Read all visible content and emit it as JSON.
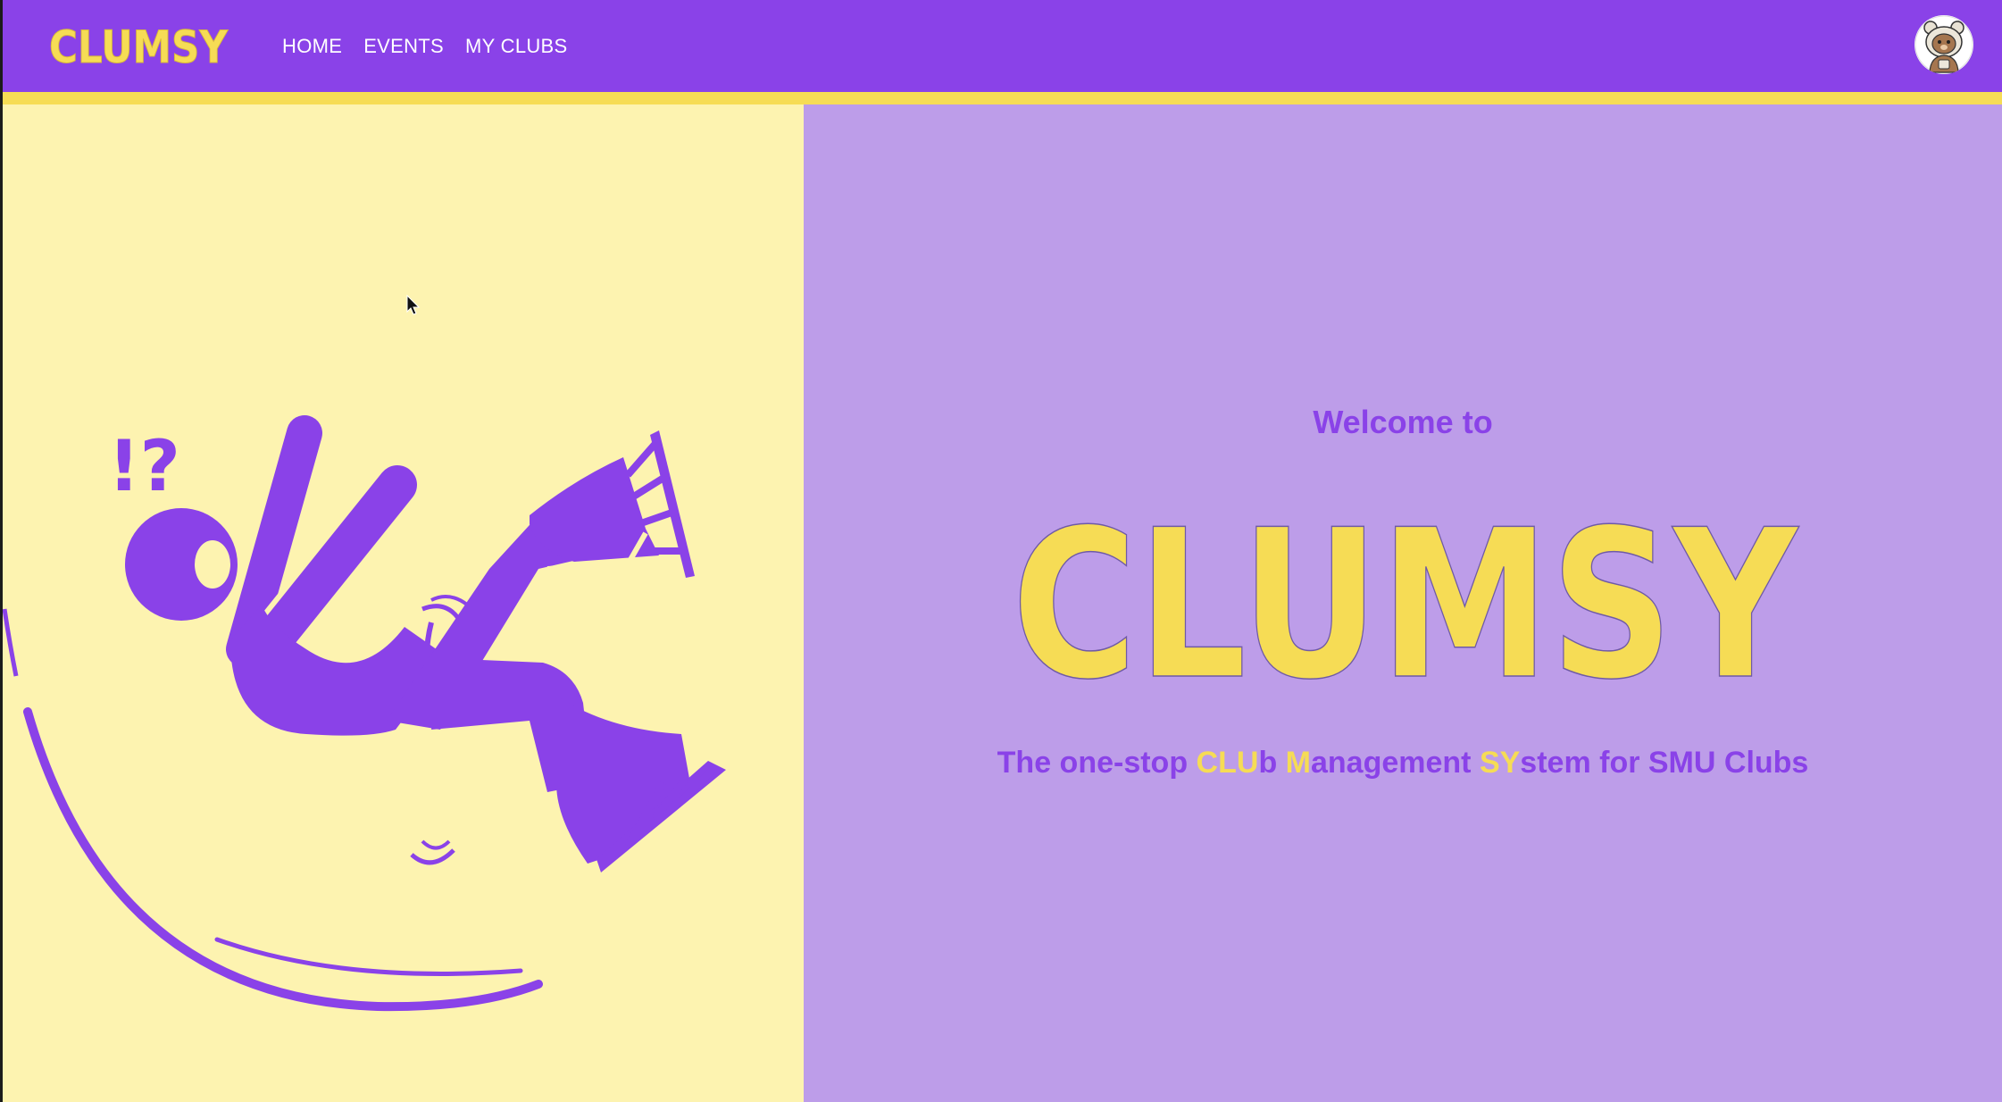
{
  "app": {
    "name": "CLUMSY"
  },
  "nav": {
    "links": [
      {
        "label": "HOME"
      },
      {
        "label": "EVENTS"
      },
      {
        "label": "MY CLUBS"
      }
    ]
  },
  "hero": {
    "welcome": "Welcome to",
    "logo_text": "CLUMSY",
    "tagline_parts": [
      "The one-stop ",
      "CLU",
      "b ",
      "M",
      "anagement ",
      "SY",
      "stem for SMU Clubs"
    ],
    "illustration_exclaim": "!?"
  },
  "colors": {
    "primary": "#8a42e8",
    "accent": "#f6dc55",
    "left_bg": "#fdf3b0",
    "right_bg": "#bd9de9"
  },
  "icons": {
    "avatar": "user-avatar-icon",
    "illustration": "falling-skater-icon",
    "cursor": "mouse-cursor-icon"
  }
}
